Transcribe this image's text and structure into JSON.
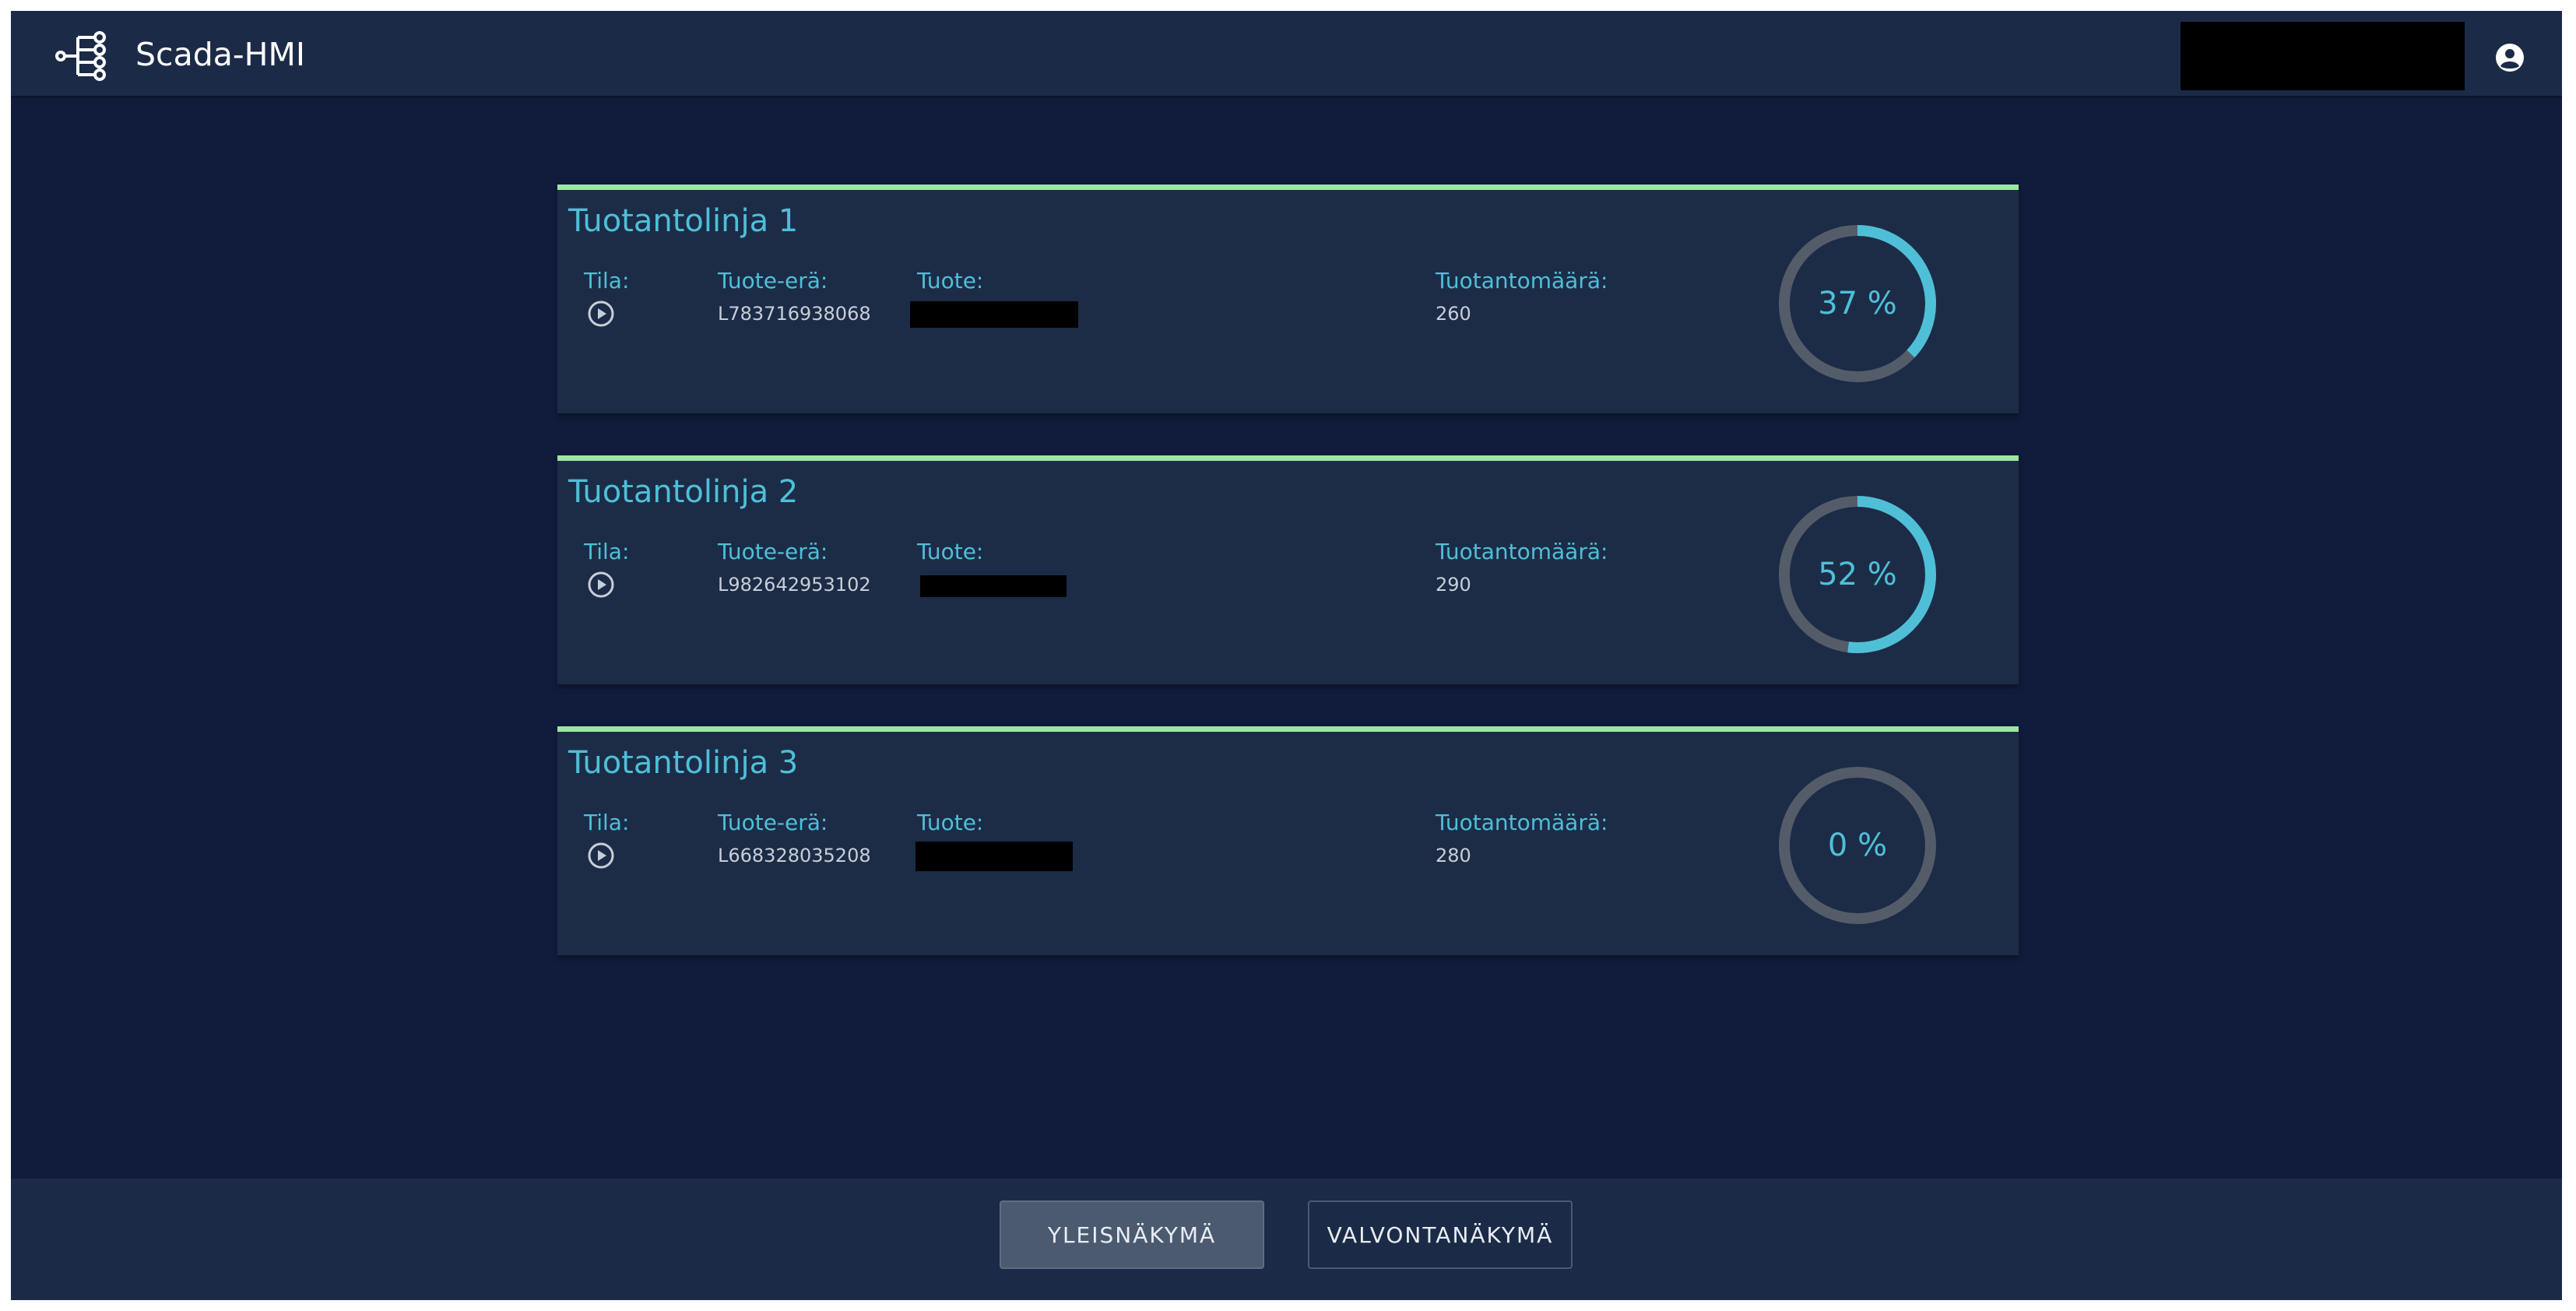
{
  "header": {
    "app_title": "Scada-HMI",
    "logo_icon": "network-nodes-icon",
    "account_icon": "account-circle-icon"
  },
  "labels": {
    "status": "Tila:",
    "batch": "Tuote-erä:",
    "product": "Tuote:",
    "quantity": "Tuotantomäärä:"
  },
  "lines": [
    {
      "title": "Tuotantolinja 1",
      "status_icon": "play-circle-icon",
      "batch": "L783716938068",
      "product": "",
      "quantity": "260",
      "progress_percent": 37,
      "progress_label": "37 %"
    },
    {
      "title": "Tuotantolinja 2",
      "status_icon": "play-circle-icon",
      "batch": "L982642953102",
      "product": "",
      "quantity": "290",
      "progress_percent": 52,
      "progress_label": "52 %"
    },
    {
      "title": "Tuotantolinja 3",
      "status_icon": "play-circle-icon",
      "batch": "L668328035208",
      "product": "",
      "quantity": "280",
      "progress_percent": 0,
      "progress_label": "0 %"
    }
  ],
  "footer": {
    "overview_label": "YLEISNÄKYMÄ",
    "monitoring_label": "VALVONTANÄKYMÄ"
  },
  "colors": {
    "background": "#111b3b",
    "panel": "#1c2c47",
    "accent": "#4fbfd8",
    "card_border": "#9be7a2",
    "gauge_track": "#545c6a"
  }
}
